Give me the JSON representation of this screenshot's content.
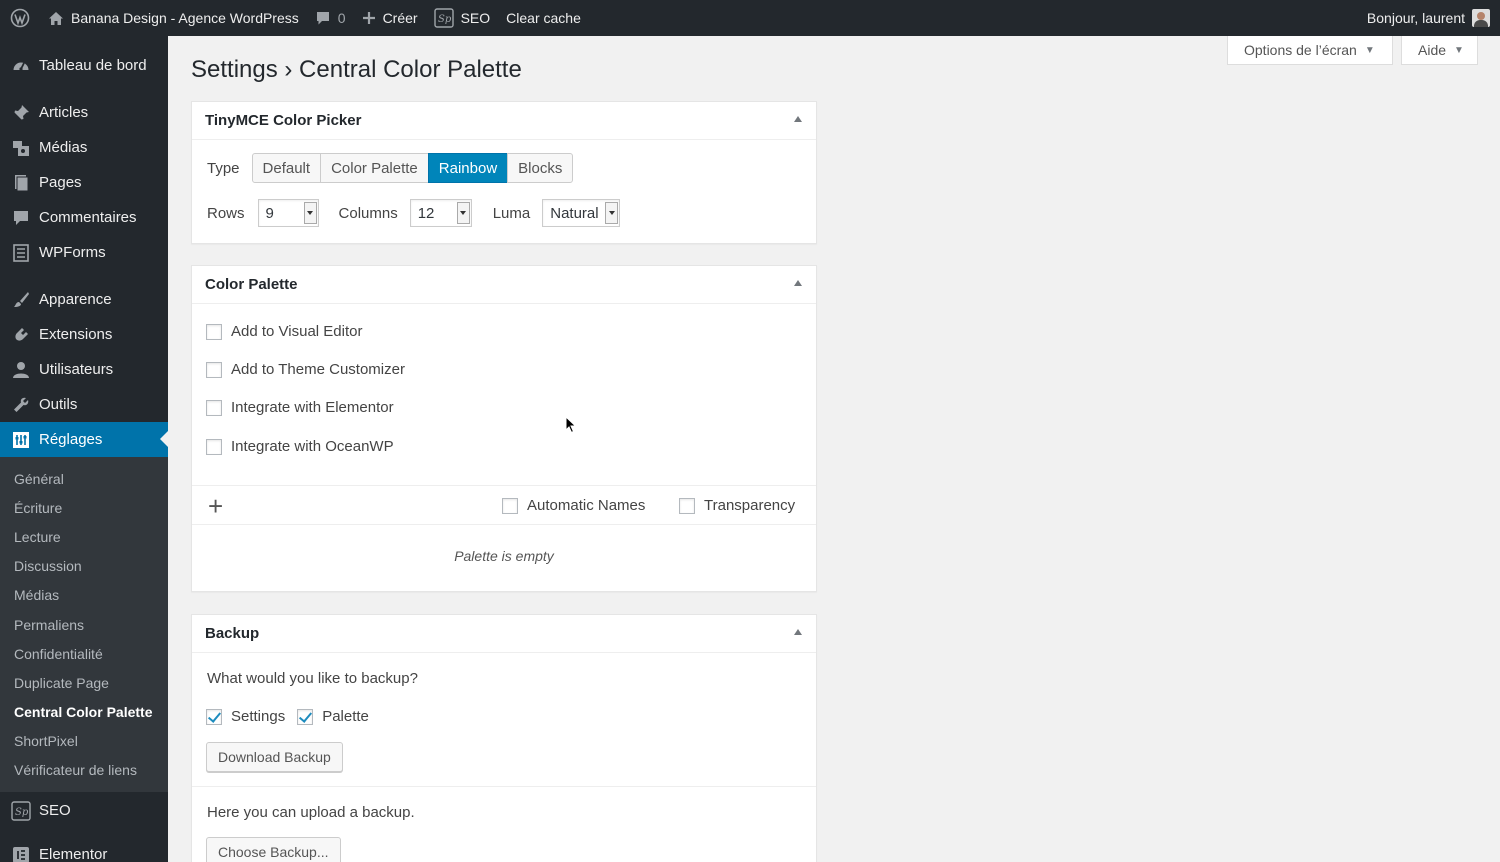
{
  "adminbar": {
    "site_name": "Banana Design - Agence WordPress",
    "comments_count": "0",
    "new_label": "Créer",
    "seo_label": "SEO",
    "clear_cache_label": "Clear cache",
    "greeting": "Bonjour, laurent"
  },
  "sidebar": {
    "items": [
      {
        "label": "Tableau de bord",
        "icon": "dashboard-icon"
      },
      {
        "label": "Articles",
        "icon": "pin-icon"
      },
      {
        "label": "Médias",
        "icon": "media-icon"
      },
      {
        "label": "Pages",
        "icon": "pages-icon"
      },
      {
        "label": "Commentaires",
        "icon": "comment-icon"
      },
      {
        "label": "WPForms",
        "icon": "form-icon"
      },
      {
        "label": "Apparence",
        "icon": "brush-icon"
      },
      {
        "label": "Extensions",
        "icon": "plugin-icon"
      },
      {
        "label": "Utilisateurs",
        "icon": "user-icon"
      },
      {
        "label": "Outils",
        "icon": "wrench-icon"
      },
      {
        "label": "Réglages",
        "icon": "settings-icon"
      },
      {
        "label": "SEO",
        "icon": "seo-icon"
      },
      {
        "label": "Elementor",
        "icon": "elementor-icon"
      }
    ],
    "submenu": [
      "Général",
      "Écriture",
      "Lecture",
      "Discussion",
      "Médias",
      "Permaliens",
      "Confidentialité",
      "Duplicate Page",
      "Central Color Palette",
      "ShortPixel",
      "Vérificateur de liens"
    ]
  },
  "screen_options": {
    "options_label": "Options de l’écran",
    "help_label": "Aide"
  },
  "page": {
    "title": "Settings › Central Color Palette"
  },
  "tinymce": {
    "title": "TinyMCE Color Picker",
    "type_label": "Type",
    "types": [
      "Default",
      "Color Palette",
      "Rainbow",
      "Blocks"
    ],
    "active_type": "Rainbow",
    "rows_label": "Rows",
    "rows_value": "9",
    "columns_label": "Columns",
    "columns_value": "12",
    "luma_label": "Luma",
    "luma_value": "Natural"
  },
  "palette": {
    "title": "Color Palette",
    "options": [
      {
        "label": "Add to Visual Editor",
        "checked": false
      },
      {
        "label": "Add to Theme Customizer",
        "checked": false
      },
      {
        "label": "Integrate with Elementor",
        "checked": false
      },
      {
        "label": "Integrate with OceanWP",
        "checked": false
      }
    ],
    "add_symbol": "+",
    "automatic_names_label": "Automatic Names",
    "transparency_label": "Transparency",
    "empty_text": "Palette is empty"
  },
  "backup": {
    "title": "Backup",
    "question": "What would you like to backup?",
    "settings_label": "Settings",
    "settings_checked": true,
    "palette_label": "Palette",
    "palette_checked": true,
    "download_label": "Download Backup",
    "upload_text": "Here you can upload a backup.",
    "choose_label": "Choose Backup..."
  },
  "colors": {
    "adminbar_bg": "#23282d",
    "accent": "#0073aa",
    "content_bg": "#f1f1f1"
  }
}
